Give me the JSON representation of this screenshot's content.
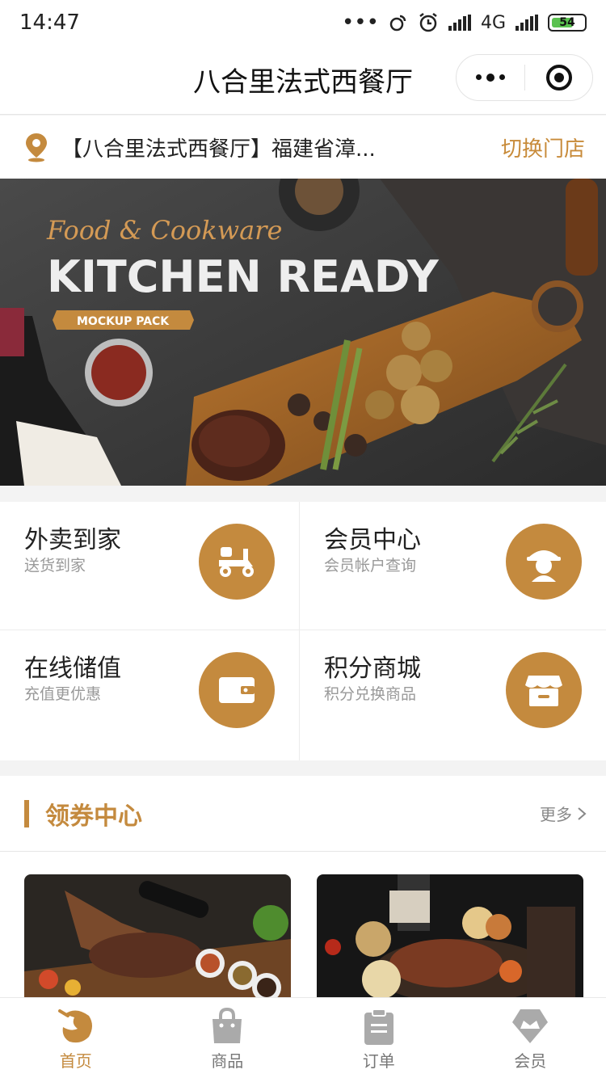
{
  "status_bar": {
    "time": "14:47",
    "network": "4G",
    "battery": "54"
  },
  "nav": {
    "title": "八合里法式西餐厅"
  },
  "store": {
    "name": "【八合里法式西餐厅】福建省漳...",
    "switch_label": "切换门店"
  },
  "banner": {
    "line1": "Food & Cookware",
    "line2": "KITCHEN READY",
    "tag": "MOCKUP PACK"
  },
  "services": [
    {
      "title": "外卖到家",
      "subtitle": "送货到家",
      "icon": "scooter-icon"
    },
    {
      "title": "会员中心",
      "subtitle": "会员帐户查询",
      "icon": "member-icon"
    },
    {
      "title": "在线储值",
      "subtitle": "充值更优惠",
      "icon": "wallet-icon"
    },
    {
      "title": "积分商城",
      "subtitle": "积分兑换商品",
      "icon": "store-icon"
    }
  ],
  "coupon_center": {
    "title": "领券中心",
    "more": "更多"
  },
  "tabs": [
    {
      "label": "首页",
      "icon": "home-icon",
      "active": true
    },
    {
      "label": "商品",
      "icon": "bag-icon",
      "active": false
    },
    {
      "label": "订单",
      "icon": "clipboard-icon",
      "active": false
    },
    {
      "label": "会员",
      "icon": "crown-icon",
      "active": false
    }
  ],
  "colors": {
    "accent": "#c48a3e",
    "active_tab": "#c48a3e"
  }
}
